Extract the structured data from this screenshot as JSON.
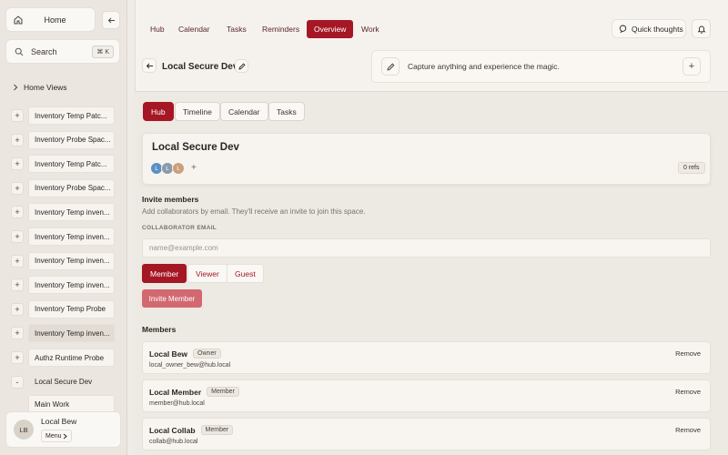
{
  "sidebar": {
    "home_label": "Home",
    "search_label": "Search",
    "search_shortcut": "⌘ K",
    "home_views_label": "Home Views",
    "items": [
      {
        "toggle": "+",
        "label": "Inventory Temp Patc..."
      },
      {
        "toggle": "+",
        "label": "Inventory Probe Spac..."
      },
      {
        "toggle": "+",
        "label": "Inventory Temp Patc..."
      },
      {
        "toggle": "+",
        "label": "Inventory Probe Spac..."
      },
      {
        "toggle": "+",
        "label": "Inventory Temp inven..."
      },
      {
        "toggle": "+",
        "label": "Inventory Temp inven..."
      },
      {
        "toggle": "+",
        "label": "Inventory Temp inven..."
      },
      {
        "toggle": "+",
        "label": "Inventory Temp inven..."
      },
      {
        "toggle": "+",
        "label": "Inventory Temp Probe"
      },
      {
        "toggle": "+",
        "label": "Inventory Temp inven..."
      },
      {
        "toggle": "+",
        "label": "Authz Runtime Probe"
      },
      {
        "toggle": "-",
        "label": "Local Secure Dev"
      }
    ],
    "child_item": "Main Work",
    "user": {
      "initials": "LB",
      "name": "Local Bew",
      "menu_label": "Menu"
    }
  },
  "topnav": {
    "tabs": [
      "Hub",
      "Calendar",
      "Tasks",
      "Reminders",
      "Overview",
      "Work"
    ],
    "active_tab": "Overview",
    "quick_thoughts": "Quick thoughts"
  },
  "header": {
    "title": "Local Secure Dev",
    "capture_placeholder": "Capture anything and experience the magic."
  },
  "subtabs": {
    "tabs": [
      "Hub",
      "Timeline",
      "Calendar",
      "Tasks"
    ],
    "active_tab": "Hub"
  },
  "space": {
    "title": "Local Secure Dev",
    "avatars": [
      {
        "initial": "L",
        "color": "#5b8fc4"
      },
      {
        "initial": "L",
        "color": "#8a9aa8"
      },
      {
        "initial": "L",
        "color": "#c9a07a"
      }
    ],
    "add_label": "+",
    "refs": "0 refs"
  },
  "invite": {
    "heading": "Invite members",
    "description": "Add collaborators by email. They'll receive an invite to join this space.",
    "email_label": "COLLABORATOR EMAIL",
    "email_placeholder": "name@example.com",
    "email_value": "",
    "roles": [
      "Member",
      "Viewer",
      "Guest"
    ],
    "selected_role": "Member",
    "invite_button": "Invite Member"
  },
  "members": {
    "heading": "Members",
    "remove_label": "Remove",
    "list": [
      {
        "name": "Local Bew",
        "role": "Owner",
        "email": "local_owner_bew@hub.local"
      },
      {
        "name": "Local Member",
        "role": "Member",
        "email": "member@hub.local"
      },
      {
        "name": "Local Collab",
        "role": "Member",
        "email": "collab@hub.local"
      }
    ]
  },
  "colors": {
    "accent": "#a51724",
    "accent_muted": "#d26870",
    "background": "#efebe6"
  }
}
